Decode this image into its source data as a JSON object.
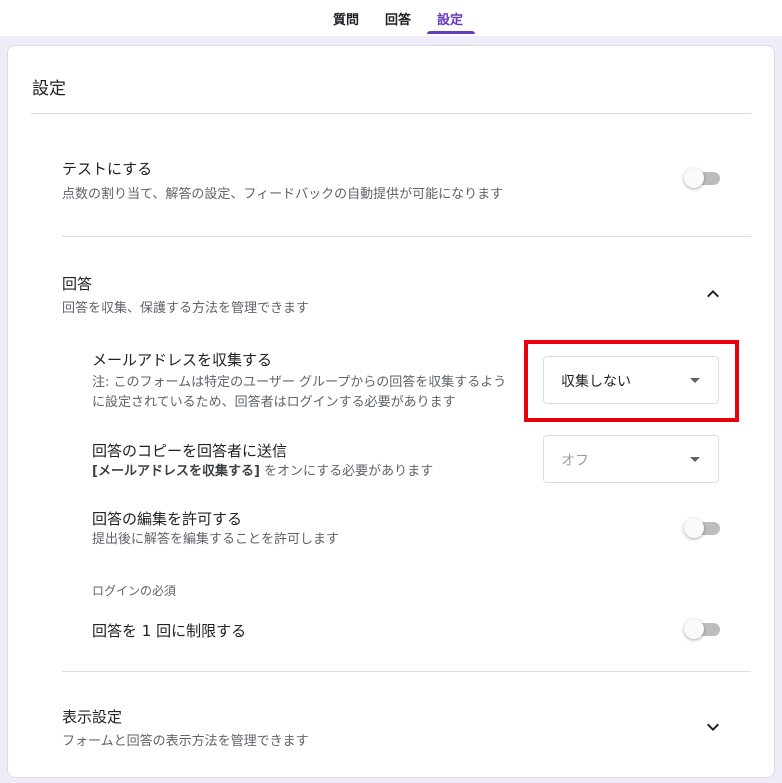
{
  "tabs": [
    {
      "label": "質問"
    },
    {
      "label": "回答"
    },
    {
      "label": "設定"
    }
  ],
  "settings": {
    "title": "設定",
    "quiz": {
      "title": "テストにする",
      "description": "点数の割り当て、解答の設定、フィードバックの自動提供が可能になります",
      "enabled": false
    },
    "responses": {
      "title": "回答",
      "description": "回答を収集、保護する方法を管理できます",
      "expanded": true,
      "collect_email": {
        "title": "メールアドレスを収集する",
        "note_line1": "注: このフォームは特定のユーザー グループからの回答を収集するよう",
        "note_line2": "に設定されているため、回答者はログインする必要があります",
        "selected": "収集しない"
      },
      "send_copy": {
        "title": "回答のコピーを回答者に送信",
        "desc_bold": "[メールアドレスを収集する]",
        "desc_rest": " をオンにする必要があります",
        "selected": "オフ"
      },
      "allow_edit": {
        "title": "回答の編集を許可する",
        "description": "提出後に解答を編集することを許可します",
        "enabled": false
      },
      "login_required_label": "ログインの必須",
      "limit_one": {
        "title": "回答を 1 回に制限する",
        "enabled": false
      }
    },
    "presentation": {
      "title": "表示設定",
      "description": "フォームと回答の表示方法を管理できます",
      "expanded": false
    }
  },
  "colors": {
    "accent": "#673ab7",
    "background": "#f0ebf8",
    "highlight": "#e8000c"
  }
}
